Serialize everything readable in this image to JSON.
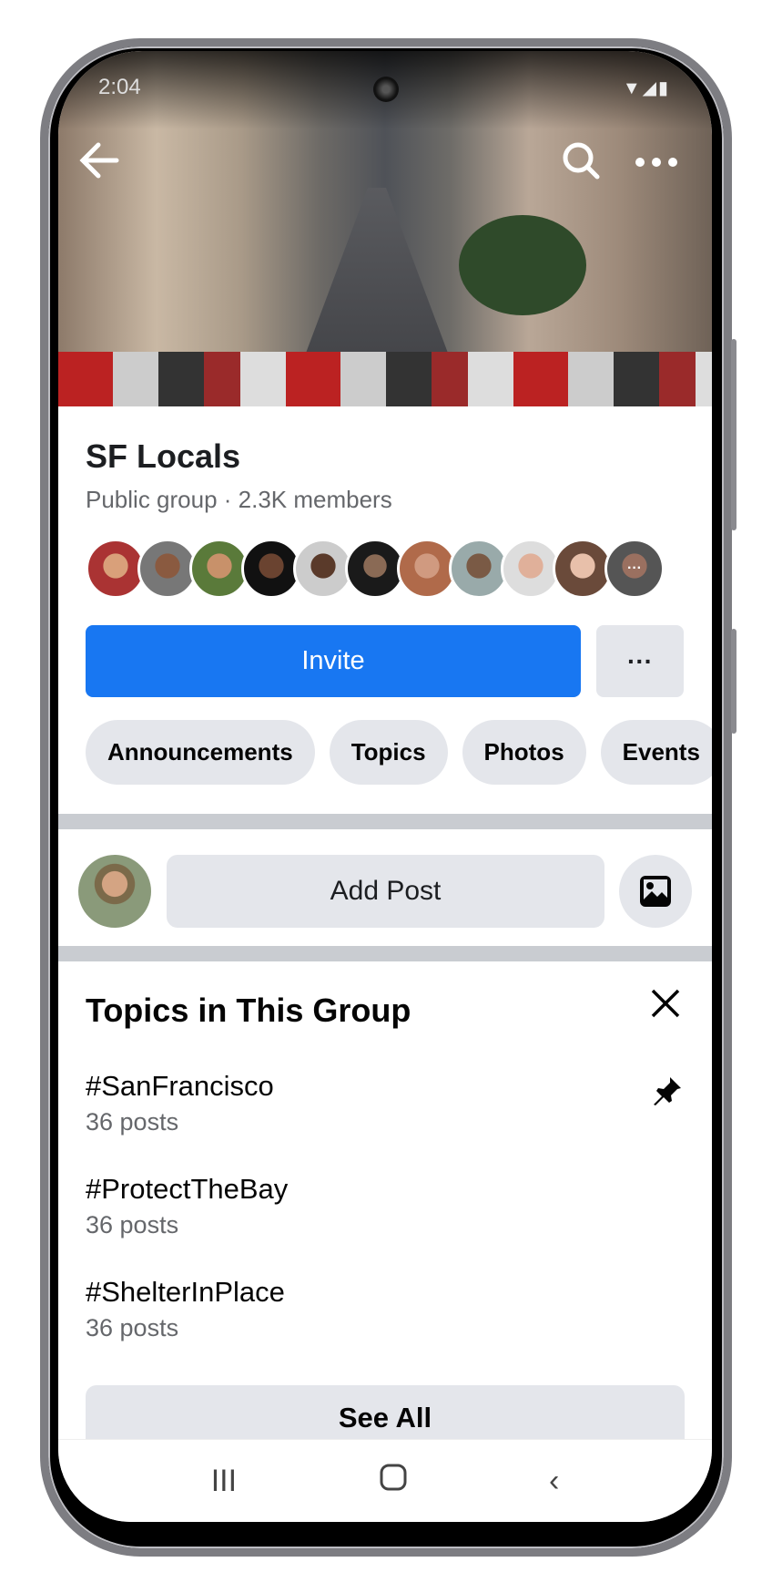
{
  "status_bar": {
    "time": "2:04",
    "icons": "▼◢▮"
  },
  "header": {
    "back_icon": "arrow-left-icon",
    "search_icon": "search-icon",
    "more_icon": "more-horizontal-icon"
  },
  "group": {
    "name": "SF Locals",
    "meta": "Public group · 2.3K members",
    "member_avatar_count": 11
  },
  "actions": {
    "invite_label": "Invite",
    "more_label": "···"
  },
  "accent_color": "#1877f2",
  "chips": [
    "Announcements",
    "Topics",
    "Photos",
    "Events"
  ],
  "composer": {
    "add_post_label": "Add Post",
    "photo_icon": "photo-icon"
  },
  "topics": {
    "title": "Topics in This Group",
    "items": [
      {
        "name": "#SanFrancisco",
        "count": "36 posts",
        "pinned": true
      },
      {
        "name": "#ProtectTheBay",
        "count": "36 posts"
      },
      {
        "name": "#ShelterInPlace",
        "count": "36 posts"
      }
    ],
    "see_all_label": "See All"
  },
  "nav": {
    "recents": "III",
    "home": "□",
    "back": "‹"
  }
}
